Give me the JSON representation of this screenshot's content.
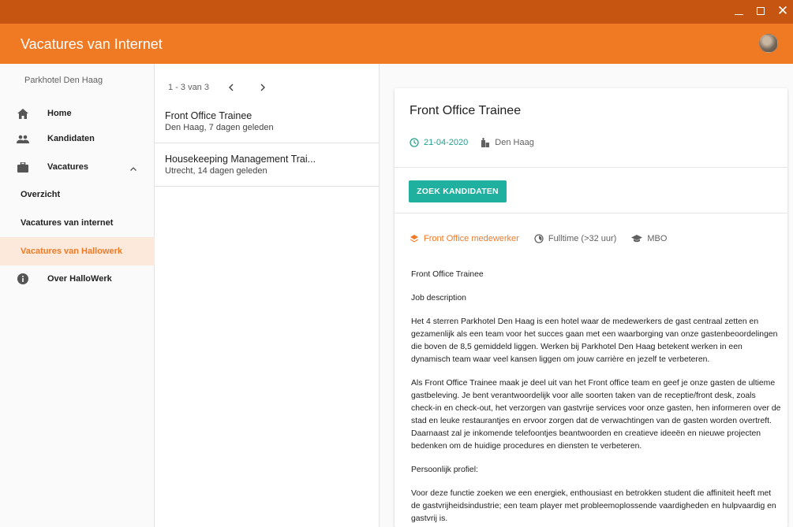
{
  "app": {
    "title": "Vacatures van Internet"
  },
  "sidebar": {
    "org_name": "Parkhotel Den Haag",
    "items": [
      {
        "label": "Home",
        "icon": "home-icon"
      },
      {
        "label": "Kandidaten",
        "icon": "people-icon"
      },
      {
        "label": "Vacatures",
        "icon": "briefcase-icon"
      }
    ],
    "sub_items": [
      {
        "label": "Overzicht"
      },
      {
        "label": "Vacatures van internet"
      },
      {
        "label": "Vacatures van Hallowerk"
      }
    ],
    "active_sub": "Vacatures van Hallowerk",
    "about": {
      "label": "Over HalloWerk",
      "icon": "info-icon"
    }
  },
  "list": {
    "pager_text": "1 - 3 van 3",
    "jobs": [
      {
        "title": "Front Office Trainee",
        "subtitle": "Den Haag, 7 dagen geleden"
      },
      {
        "title": "Housekeeping Management Trai...",
        "subtitle": "Utrecht, 14 dagen geleden"
      }
    ]
  },
  "detail": {
    "title": "Front Office Trainee",
    "date": "21-04-2020",
    "location": "Den Haag",
    "button_label": "ZOEK KANDIDATEN",
    "tags": {
      "function": "Front Office medewerker",
      "hours": "Fulltime (>32 uur)",
      "education": "MBO"
    },
    "description": [
      "Front Office Trainee",
      "Job description",
      "Het 4 sterren Parkhotel Den Haag is een hotel waar de medewerkers de gast centraal zetten en gezamenlijk als een team voor het succes gaan met een waarborging van onze gastenbeoordelingen die boven de 8,5 gemiddeld liggen. Werken bij Parkhotel Den Haag betekent werken in een dynamisch team waar veel kansen liggen om jouw carrière en jezelf te verbeteren.",
      "Als Front Office Trainee maak je deel uit van het Front office team en geef je onze gasten de ultieme gastbeleving. Je bent verantwoordelijk voor alle soorten taken van de receptie/front desk, zoals check-in en check-out, het verzorgen van gastvrije services voor onze gasten, hen informeren over de stad en leuke restaurantjes en ervoor zorgen dat de verwachtingen van de gasten worden overtreft. Daarnaast zal je inkomende telefoontjes beantwoorden en creatieve ideeën en nieuwe projecten bedenken om de huidige procedures en diensten te verbeteren.",
      "Persoonlijk profiel:",
      "Voor deze functie zoeken we een energiek, enthousiast en betrokken student die affiniteit heeft met de gastvrijheidsindustrie; een team player met probleemoplossende vaardigheden en hulpvaardig en gastvrij is."
    ]
  },
  "colors": {
    "titlebar": "#c55510",
    "appbar": "#f07a24",
    "accent_teal": "#1fb0a0",
    "active_bg": "#fde9dc"
  }
}
